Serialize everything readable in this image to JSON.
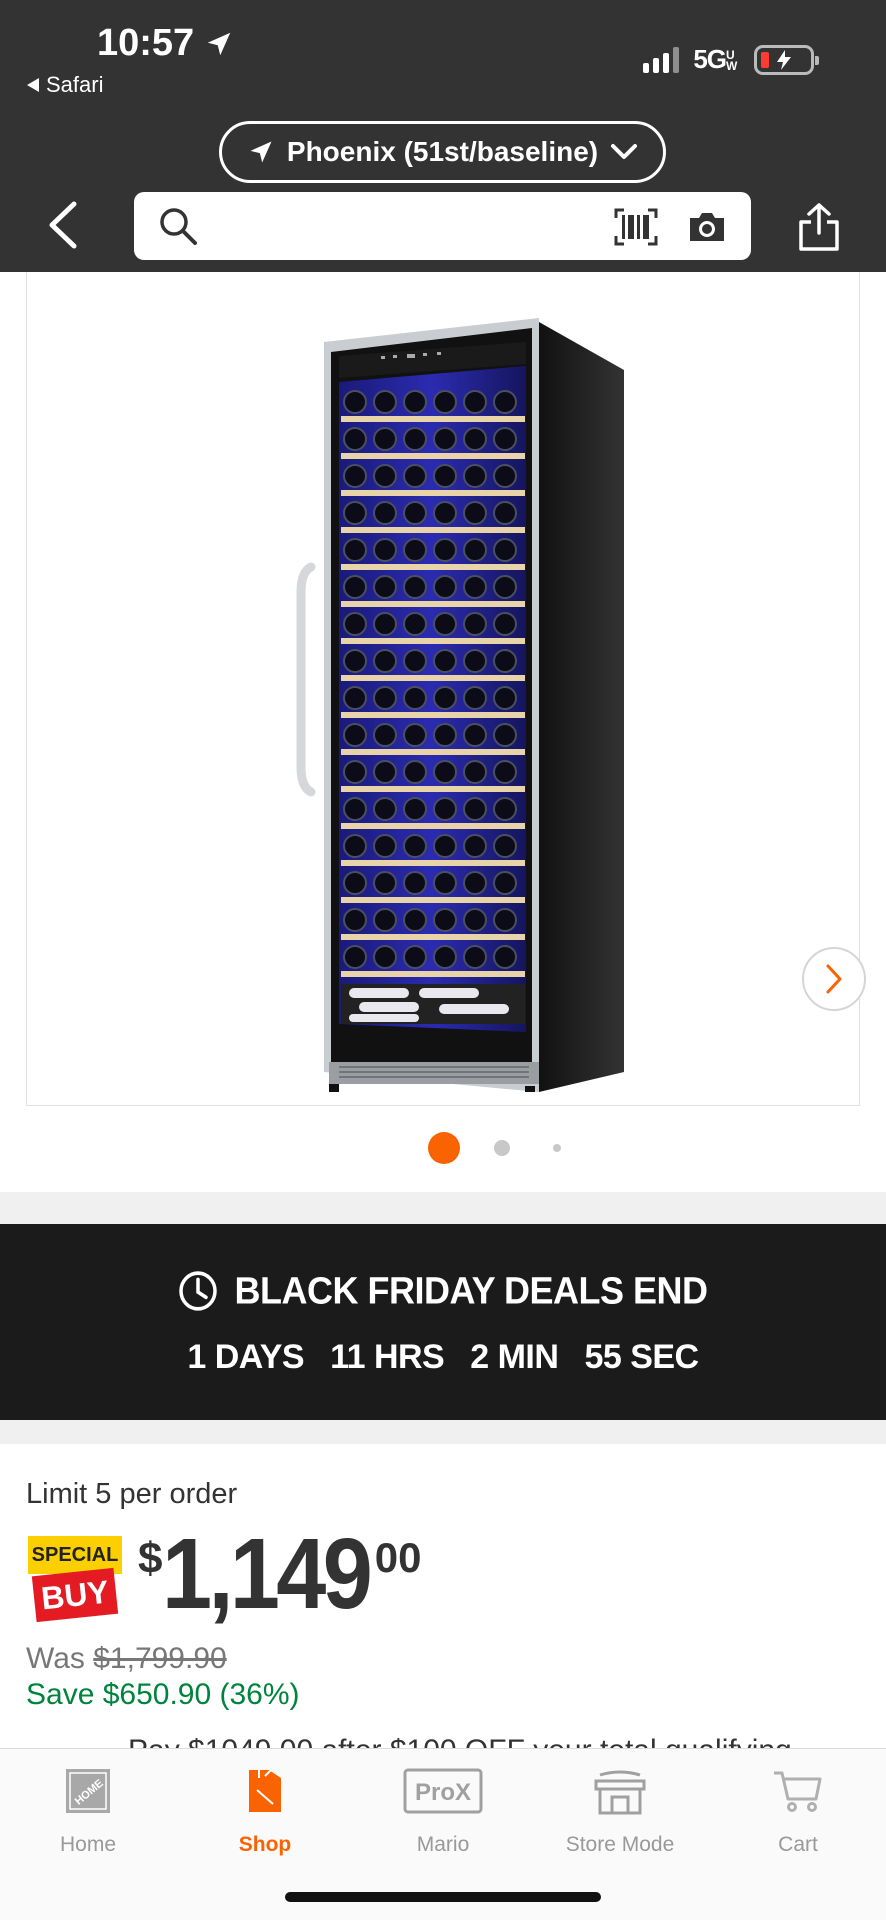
{
  "status_bar": {
    "time": "10:57",
    "back_app": "Safari",
    "network": "5G",
    "network_suffix": "UW"
  },
  "header": {
    "store_name": "Phoenix (51st/baseline)",
    "search": {
      "value": "",
      "placeholder": ""
    }
  },
  "gallery": {
    "image_alt": "Wine cooler",
    "dots": 3,
    "active_index": 0,
    "accent": "#f96302"
  },
  "banner": {
    "title": "BLACK FRIDAY DEALS END",
    "days": "1 DAYS",
    "hours": "11 HRS",
    "minutes": "2 MIN",
    "seconds": "55 SEC"
  },
  "pricing": {
    "limit": "Limit 5 per order",
    "badge_top": "SPECIAL",
    "badge_bottom": "BUY",
    "currency": "$",
    "dollars": "1,149",
    "cents": "00",
    "was_label": "Was",
    "was_price": "$1,799.90",
    "save_text": "Save $650.90 (36%)",
    "cut_text": "Pay $1049.00 after $100 OFF your total qualifying"
  },
  "tabs": [
    {
      "label": "Home",
      "icon": "home-depot-logo-icon"
    },
    {
      "label": "Shop",
      "icon": "shop-icon"
    },
    {
      "label": "Mario",
      "icon": "prox-icon"
    },
    {
      "label": "Store Mode",
      "icon": "store-icon"
    },
    {
      "label": "Cart",
      "icon": "cart-icon"
    }
  ],
  "colors": {
    "brand_orange": "#f96302",
    "save_green": "#00843d",
    "header_bg": "#333333",
    "banner_bg": "#1b1b1b"
  }
}
